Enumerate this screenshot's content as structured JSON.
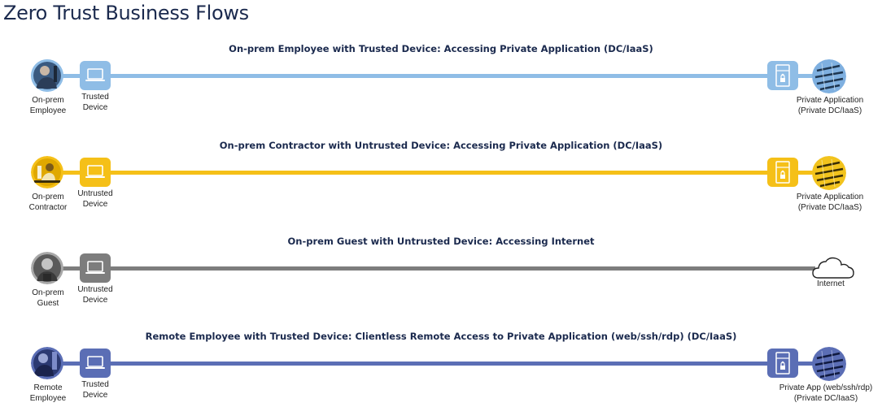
{
  "page": {
    "title": "Zero Trust Business Flows"
  },
  "colors": {
    "employee": "#8fbde6",
    "contractor": "#f5c018",
    "guest": "#7d7d7d",
    "remote": "#5b6eb5",
    "title_text": "#1b2a4e"
  },
  "flows": [
    {
      "title": "On-prem Employee with Trusted Device: Accessing Private Application (DC/IaaS)",
      "person_label_line1": "On-prem",
      "person_label_line2": "Employee",
      "device_label_line1": "Trusted",
      "device_label_line2": "Device",
      "person_icon": "employee-avatar",
      "device_icon": "laptop-icon",
      "server_icon": "server-lock-icon",
      "dest_icon": "datacenter-icon",
      "dest_label_line1": "Private Application",
      "dest_label_line2": "(Private DC/IaaS)"
    },
    {
      "title": "On-prem Contractor with Untrusted Device: Accessing Private Application (DC/IaaS)",
      "person_label_line1": "On-prem",
      "person_label_line2": "Contractor",
      "device_label_line1": "Untrusted",
      "device_label_line2": "Device",
      "person_icon": "contractor-avatar",
      "device_icon": "laptop-icon",
      "server_icon": "server-lock-icon",
      "dest_icon": "datacenter-icon",
      "dest_label_line1": "Private Application",
      "dest_label_line2": "(Private DC/IaaS)"
    },
    {
      "title": "On-prem Guest with Untrusted Device: Accessing Internet",
      "person_label_line1": "On-prem",
      "person_label_line2": "Guest",
      "device_label_line1": "Untrusted",
      "device_label_line2": "Device",
      "person_icon": "guest-avatar",
      "device_icon": "laptop-icon",
      "dest_icon": "cloud-icon",
      "dest_label_line1": "Internet",
      "dest_label_line2": ""
    },
    {
      "title": "Remote Employee with Trusted Device: Clientless Remote Access to Private Application (web/ssh/rdp) (DC/IaaS)",
      "person_label_line1": "Remote",
      "person_label_line2": "Employee",
      "device_label_line1": "Trusted",
      "device_label_line2": "Device",
      "person_icon": "remote-employee-avatar",
      "device_icon": "laptop-icon",
      "server_icon": "server-lock-icon",
      "dest_icon": "datacenter-icon",
      "dest_label_line1": "Private App (web/ssh/rdp)",
      "dest_label_line2": "(Private DC/IaaS)"
    }
  ]
}
